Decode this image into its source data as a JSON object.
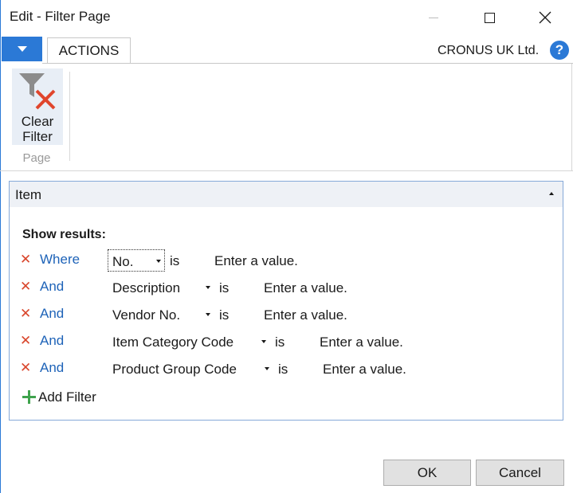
{
  "window": {
    "title": "Edit - Filter Page"
  },
  "ribbon": {
    "tabs": [
      {
        "label": "ACTIONS"
      }
    ],
    "company": "CRONUS UK Ltd.",
    "help_icon": "question-circle-icon",
    "actions": [
      {
        "label_line1": "Clear",
        "label_line2": "Filter",
        "icon": "clear-filter-icon"
      }
    ],
    "group_label": "Page"
  },
  "panel": {
    "title": "Item",
    "show_results_label": "Show results:",
    "filters": [
      {
        "conjunction": "Where",
        "field": "No.",
        "operator": "is",
        "value_placeholder": "Enter a value."
      },
      {
        "conjunction": "And",
        "field": "Description",
        "operator": "is",
        "value_placeholder": "Enter a value."
      },
      {
        "conjunction": "And",
        "field": "Vendor No.",
        "operator": "is",
        "value_placeholder": "Enter a value."
      },
      {
        "conjunction": "And",
        "field": "Item Category Code",
        "operator": "is",
        "value_placeholder": "Enter a value."
      },
      {
        "conjunction": "And",
        "field": "Product Group Code",
        "operator": "is",
        "value_placeholder": "Enter a value."
      }
    ],
    "add_filter_label": "Add Filter"
  },
  "buttons": {
    "ok": "OK",
    "cancel": "Cancel"
  },
  "colors": {
    "accent": "#2b79d6",
    "link": "#1e63b8",
    "remove": "#d9462c",
    "add": "#3fa34d"
  }
}
